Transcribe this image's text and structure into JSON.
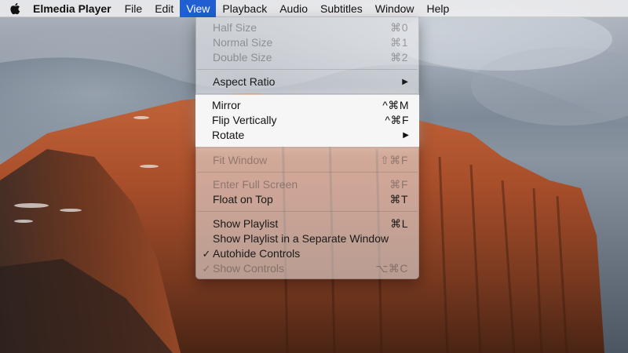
{
  "colors": {
    "menu_highlight": "#1f5fd1",
    "menubar_bg": "#ececee",
    "spotlight_bg": "#f6f6f7"
  },
  "menubar": {
    "apple_icon": "apple-logo-icon",
    "app_name": "Elmedia Player",
    "menus": [
      {
        "label": "File"
      },
      {
        "label": "Edit"
      },
      {
        "label": "View"
      },
      {
        "label": "Playback"
      },
      {
        "label": "Audio"
      },
      {
        "label": "Subtitles"
      },
      {
        "label": "Window"
      },
      {
        "label": "Help"
      }
    ],
    "active_menu": "View"
  },
  "view_menu": {
    "groups": [
      [
        {
          "label": "Half Size",
          "shortcut": "⌘0",
          "enabled": false
        },
        {
          "label": "Normal Size",
          "shortcut": "⌘1",
          "enabled": false
        },
        {
          "label": "Double Size",
          "shortcut": "⌘2",
          "enabled": false
        }
      ],
      [
        {
          "label": "Aspect Ratio",
          "shortcut": "▶",
          "enabled": true,
          "submenu": true
        }
      ],
      [
        {
          "label": "Mirror",
          "shortcut": "^⌘M",
          "enabled": true
        },
        {
          "label": "Flip Vertically",
          "shortcut": "^⌘F",
          "enabled": true
        },
        {
          "label": "Rotate",
          "shortcut": "▶",
          "enabled": true,
          "submenu": true
        }
      ],
      [
        {
          "label": "Fit Window",
          "shortcut": "⇧⌘F",
          "enabled": false
        }
      ],
      [
        {
          "label": "Enter Full Screen",
          "shortcut": "⌘F",
          "enabled": false
        },
        {
          "label": "Float on Top",
          "shortcut": "⌘T",
          "enabled": true
        }
      ],
      [
        {
          "label": "Show Playlist",
          "shortcut": "⌘L",
          "enabled": true
        },
        {
          "label": "Show Playlist in a Separate Window",
          "shortcut": "",
          "enabled": true
        },
        {
          "label": "Autohide Controls",
          "shortcut": "",
          "enabled": true,
          "checked": true
        },
        {
          "label": "Show Controls",
          "shortcut": "⌥⌘C",
          "enabled": false,
          "checked": true
        }
      ]
    ]
  }
}
